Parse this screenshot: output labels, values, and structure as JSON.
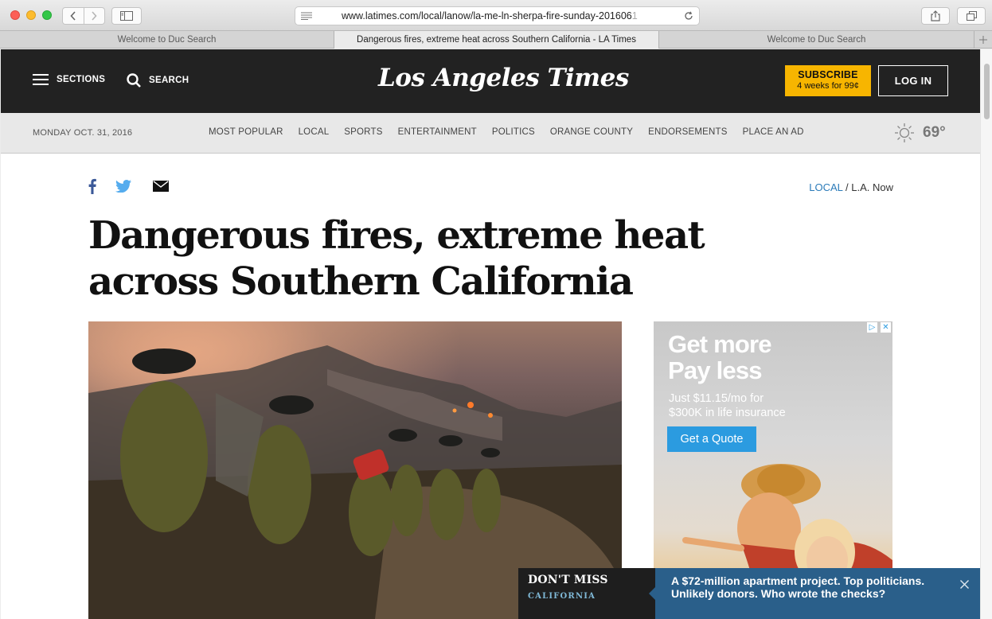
{
  "browser": {
    "url_main": "www.latimes.com/local/lanow/la-me-ln-sherpa-fire-sunday-201606",
    "url_faded": "1",
    "tabs": [
      {
        "title": "Welcome to Duc Search"
      },
      {
        "title": "Dangerous fires, extreme heat across Southern California - LA Times"
      },
      {
        "title": "Welcome to Duc Search"
      }
    ]
  },
  "masthead": {
    "sections_label": "SECTIONS",
    "search_label": "SEARCH",
    "logo_text": "Los Angeles Times",
    "subscribe_title": "SUBSCRIBE",
    "subscribe_offer": "4 weeks for 99¢",
    "login_label": "LOG IN"
  },
  "subnav": {
    "date": "MONDAY OCT. 31, 2016",
    "links": [
      "MOST POPULAR",
      "LOCAL",
      "SPORTS",
      "ENTERTAINMENT",
      "POLITICS",
      "ORANGE COUNTY",
      "ENDORSEMENTS",
      "PLACE AN AD"
    ],
    "temperature": "69°"
  },
  "article": {
    "section": "LOCAL",
    "separator": " / ",
    "subsection": "L.A. Now",
    "headline": "Dangerous fires, extreme heat across Southern California"
  },
  "ad": {
    "headline_line1": "Get more",
    "headline_line2": "Pay less",
    "sub_line1": "Just $11.15/mo for",
    "sub_line2": "$300K in life insurance",
    "cta": "Get a Quote"
  },
  "dont_miss": {
    "title": "DON'T MISS",
    "category": "CALIFORNIA",
    "story": "A $72-million apartment project. Top politicians. Unlikely donors. Who wrote the checks?"
  },
  "colors": {
    "masthead_bg": "#222222",
    "subscribe_bg": "#f7b500",
    "link_blue": "#2b7bb9",
    "dont_miss_blue": "#2a5f8a"
  }
}
